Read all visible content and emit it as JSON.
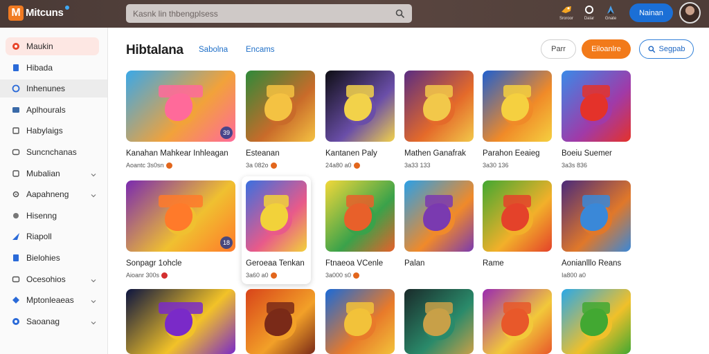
{
  "app": {
    "logo_letter": "M",
    "logo_text": "Mitcuns",
    "search_placeholder": "Kasnk lin thbengplsess",
    "signin_label": "Nainan",
    "top_icons": [
      {
        "name": "rocket-icon",
        "label": "Sroroor"
      },
      {
        "name": "location-icon",
        "label": "Dalar"
      },
      {
        "name": "dart-icon",
        "label": "Gnate"
      }
    ]
  },
  "sidebar": {
    "items": [
      {
        "label": "Maukin",
        "icon": "home-icon",
        "active": true,
        "chevron": false
      },
      {
        "label": "Hibada",
        "icon": "bookmark-icon",
        "active": false,
        "chevron": false
      },
      {
        "label": "Inhenunes",
        "icon": "circle-icon",
        "active": false,
        "hover": true,
        "chevron": false
      },
      {
        "label": "Aplhourals",
        "icon": "card-icon",
        "active": false,
        "chevron": false
      },
      {
        "label": "Habylaigs",
        "icon": "list-icon",
        "active": false,
        "chevron": false
      },
      {
        "label": "Suncnchanas",
        "icon": "chat-icon",
        "active": false,
        "chevron": false
      },
      {
        "label": "Mubalian",
        "icon": "square-icon",
        "active": false,
        "chevron": true
      },
      {
        "label": "Aapahneng",
        "icon": "gear-icon",
        "active": false,
        "chevron": true
      },
      {
        "label": "Hisenng",
        "icon": "dot-icon",
        "active": false,
        "chevron": false
      },
      {
        "label": "Riapoll",
        "icon": "send-icon",
        "active": false,
        "chevron": false
      },
      {
        "label": "Bielohies",
        "icon": "box-icon",
        "active": false,
        "chevron": false
      },
      {
        "label": "Ocesohios",
        "icon": "folder-icon",
        "active": false,
        "chevron": true
      },
      {
        "label": "Mptonleaeas",
        "icon": "diamond-icon",
        "active": false,
        "chevron": true
      },
      {
        "label": "Saoanag",
        "icon": "globe-icon",
        "active": false,
        "chevron": true
      }
    ]
  },
  "main": {
    "title": "Hibtalana",
    "tabs": [
      "Sabolna",
      "Encams"
    ],
    "buttons": {
      "plain": "Parr",
      "orange": "Eiloanlre",
      "outline": "Segpab"
    }
  },
  "cards": [
    {
      "title": "Kanahan Mahkear Inhleagan",
      "meta": "Aoantc 3s0sn",
      "coin": "orange",
      "badge": "39",
      "colors": [
        "#3aa8e8",
        "#f2a23a",
        "#ff6a9a"
      ]
    },
    {
      "title": "Esteanan",
      "meta": "3a 082o",
      "coin": "orange",
      "badge": "",
      "colors": [
        "#2e8a3a",
        "#c96b2a",
        "#f4c242"
      ]
    },
    {
      "title": "Kantanen Paly",
      "meta": "24a80 a0",
      "coin": "orange",
      "badge": "",
      "colors": [
        "#0e0e14",
        "#6a4ea8",
        "#f2d24a"
      ]
    },
    {
      "title": "Mathen Ganafrak",
      "meta": "3a33 133",
      "coin": "",
      "badge": "",
      "colors": [
        "#5a2c82",
        "#e46a2a",
        "#f2c84a"
      ]
    },
    {
      "title": "Parahon Eeaieg",
      "meta": "3a30 136",
      "coin": "",
      "badge": "",
      "colors": [
        "#1e5fd0",
        "#f08a28",
        "#f5d040"
      ]
    },
    {
      "title": "Boeiu Suemer",
      "meta": "3a3s 836",
      "coin": "",
      "badge": "",
      "colors": [
        "#3a8ae8",
        "#a03aa8",
        "#e4322a"
      ]
    },
    {
      "title": "Sonpagr 1ohcle",
      "meta": "Aioanr 300s",
      "coin": "red",
      "badge": "18",
      "colors": [
        "#7a2ab0",
        "#f0c030",
        "#ff7a2a"
      ]
    },
    {
      "title": "Geroeaa Tenkan",
      "meta": "3a60 a0",
      "coin": "orange",
      "badge": "",
      "colors": [
        "#3a70e0",
        "#e85a8a",
        "#f2d23a"
      ]
    },
    {
      "title": "Ftnaeoa VCenle",
      "meta": "3a000 s0",
      "coin": "orange",
      "badge": "",
      "colors": [
        "#f2d83a",
        "#3aa24a",
        "#e8602a"
      ]
    },
    {
      "title": "Palan",
      "meta": "",
      "coin": "",
      "badge": "",
      "colors": [
        "#2aa0e8",
        "#f08a2a",
        "#7a3ab0"
      ]
    },
    {
      "title": "Rame",
      "meta": "",
      "coin": "",
      "badge": "",
      "colors": [
        "#42a832",
        "#f2b02a",
        "#e4422a"
      ]
    },
    {
      "title": "Aonianlllo Reans",
      "meta": "Ia800 a0",
      "coin": "",
      "badge": "",
      "colors": [
        "#4a2a7a",
        "#e0782a",
        "#3a88d8"
      ]
    },
    {
      "title": "",
      "meta": "",
      "coin": "",
      "badge": "",
      "colors": [
        "#0c1440",
        "#f2c228",
        "#7a2ac8"
      ]
    },
    {
      "title": "",
      "meta": "",
      "coin": "",
      "badge": "",
      "colors": [
        "#d8441a",
        "#f2a028",
        "#7a2a18"
      ]
    },
    {
      "title": "",
      "meta": "",
      "coin": "",
      "badge": "",
      "colors": [
        "#1a6ad8",
        "#e87a2a",
        "#f2c23a"
      ]
    },
    {
      "title": "",
      "meta": "",
      "coin": "",
      "badge": "",
      "colors": [
        "#1a2a2a",
        "#2a8a6a",
        "#c8a048"
      ]
    },
    {
      "title": "",
      "meta": "",
      "coin": "",
      "badge": "",
      "colors": [
        "#9a2ab0",
        "#f2c83a",
        "#e8582a"
      ]
    },
    {
      "title": "",
      "meta": "",
      "coin": "",
      "badge": "",
      "colors": [
        "#2aa8e8",
        "#f0c02a",
        "#42a832"
      ]
    }
  ]
}
